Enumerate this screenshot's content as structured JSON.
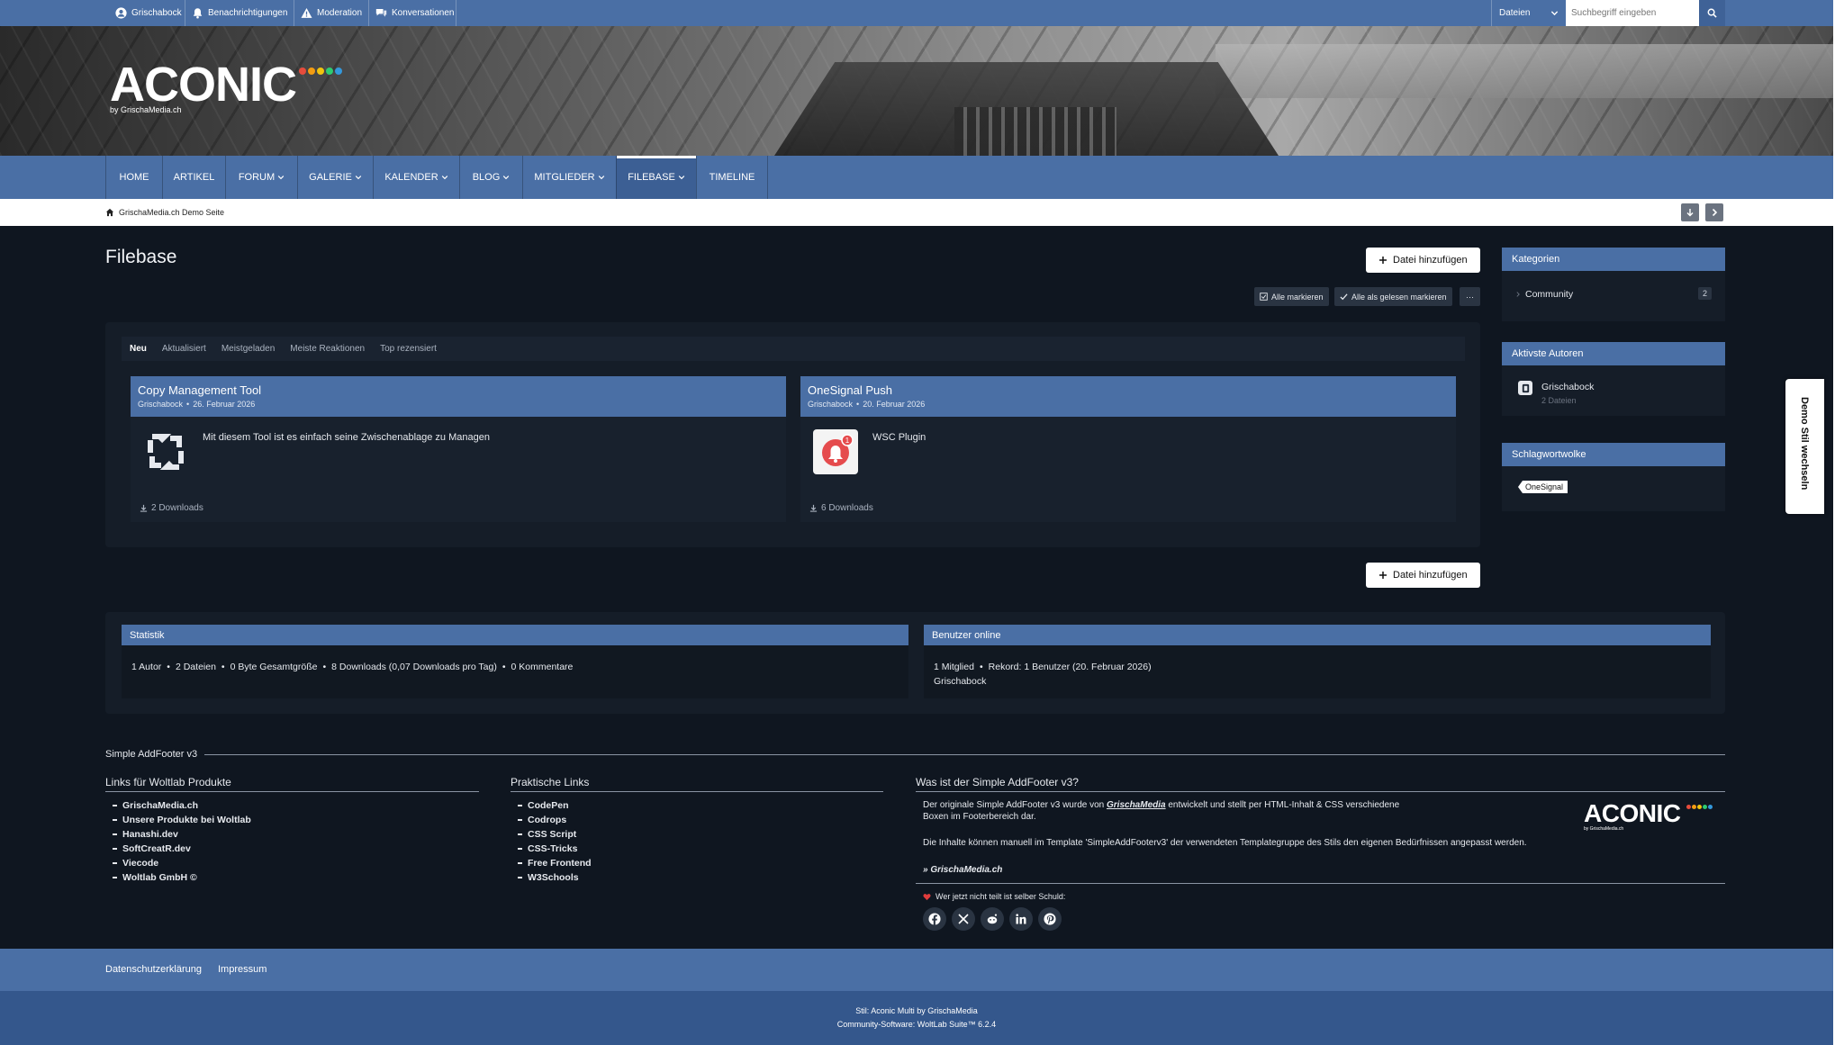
{
  "userbar": {
    "items": [
      {
        "label": "Grischabock",
        "icon": "user-icon"
      },
      {
        "label": "Benachrichtigungen",
        "icon": "bell-icon"
      },
      {
        "label": "Moderation",
        "icon": "warning-icon"
      },
      {
        "label": "Konversationen",
        "icon": "chat-icon"
      }
    ],
    "search_scope": "Dateien",
    "search_placeholder": "Suchbegriff eingeben"
  },
  "logo": {
    "text": "ACONIC",
    "sub": "by GrischaMedia.ch",
    "dot_colors": [
      "#e74c3c",
      "#f39c12",
      "#f1c40f",
      "#2ecc71",
      "#3498db"
    ]
  },
  "nav": {
    "items": [
      {
        "label": "HOME",
        "dropdown": false
      },
      {
        "label": "ARTIKEL",
        "dropdown": false
      },
      {
        "label": "FORUM",
        "dropdown": true
      },
      {
        "label": "GALERIE",
        "dropdown": true
      },
      {
        "label": "KALENDER",
        "dropdown": true
      },
      {
        "label": "BLOG",
        "dropdown": true
      },
      {
        "label": "MITGLIEDER",
        "dropdown": true
      },
      {
        "label": "FILEBASE",
        "dropdown": true,
        "active": true
      },
      {
        "label": "TIMELINE",
        "dropdown": false
      }
    ]
  },
  "breadcrumb": {
    "label": "GrischaMedia.ch Demo Seite"
  },
  "page": {
    "title": "Filebase",
    "add_file_label": "Datei hinzufügen",
    "mark_all_label": "Alle markieren",
    "mark_read_label": "Alle als gelesen markieren",
    "more_label": "···"
  },
  "tabs": [
    {
      "label": "Neu",
      "active": true
    },
    {
      "label": "Aktualisiert"
    },
    {
      "label": "Meistgeladen"
    },
    {
      "label": "Meiste Reaktionen"
    },
    {
      "label": "Top rezensiert"
    }
  ],
  "files": [
    {
      "title": "Copy Management Tool",
      "author": "Grischabock",
      "date": "26. Februar 2026",
      "description": "Mit diesem Tool ist es einfach seine Zwischenablage zu Managen",
      "downloads": "2 Downloads",
      "icon": "refresh-arrows-icon"
    },
    {
      "title": "OneSignal Push",
      "author": "Grischabock",
      "date": "20. Februar 2026",
      "description": "WSC Plugin",
      "downloads": "6 Downloads",
      "icon": "onesignal-bell-icon",
      "badge": "1"
    }
  ],
  "sidebar": {
    "categories": {
      "title": "Kategorien",
      "items": [
        {
          "label": "Community",
          "count": "2"
        }
      ]
    },
    "authors": {
      "title": "Aktivste Autoren",
      "items": [
        {
          "name": "Grischabock",
          "files": "2 Dateien"
        }
      ]
    },
    "tags": {
      "title": "Schlagwortwolke",
      "items": [
        "OneSignal"
      ]
    }
  },
  "stats": {
    "title": "Statistik",
    "items": [
      "1 Autor",
      "2 Dateien",
      "0 Byte Gesamtgröße",
      "8 Downloads (0,07 Downloads pro Tag)",
      "0 Kommentare"
    ]
  },
  "online": {
    "title": "Benutzer online",
    "items": [
      "1 Mitglied",
      "Rekord: 1 Benutzer (20. Februar 2026)"
    ],
    "users": "Grischabock"
  },
  "addfooter": {
    "title": "Simple AddFooter v3",
    "col1": {
      "title": "Links für Woltlab Produkte",
      "links": [
        "GrischaMedia.ch",
        "Unsere Produkte bei Woltlab",
        "Hanashi.dev",
        "SoftCreatR.dev",
        "Viecode",
        "Woltlab GmbH ©"
      ]
    },
    "col2": {
      "title": "Praktische Links",
      "links": [
        "CodePen",
        "Codrops",
        "CSS Script",
        "CSS-Tricks",
        "Free Frontend",
        "W3Schools"
      ]
    },
    "col3": {
      "title": "Was ist der Simple AddFooter v3?",
      "text1_a": "Der originale Simple AddFooter v3 wurde von",
      "text1_em": "GrischaMedia",
      "text1_b": "entwickelt und stellt per HTML-Inhalt & CSS verschiedene Boxen im Footerbereich dar.",
      "text2": "Die Inhalte können manuell im Template 'SimpleAddFooterv3' der verwendeten Templategruppe des Stils den eigenen Bedürfnissen angepasst werden.",
      "link": "» GrischaMedia.ch",
      "logo": "ACONIC",
      "logo_sub": "by GrischaMedia.ch",
      "share_text": "Wer jetzt nicht teilt ist selber Schuld:",
      "social": [
        "facebook-icon",
        "x-icon",
        "reddit-icon",
        "linkedin-icon",
        "pinterest-icon"
      ]
    }
  },
  "footer": {
    "links": [
      "Datenschutzerklärung",
      "Impressum"
    ],
    "style_line": "Stil: Aconic Multi by GrischaMedia",
    "software_line": "Community-Software: WoltLab Suite™ 6.2.4"
  },
  "demo_tab": "Demo Stil wechseln",
  "colors": {
    "accent": "#4a6fa5",
    "background": "#0f1620",
    "panel": "#151d28"
  }
}
